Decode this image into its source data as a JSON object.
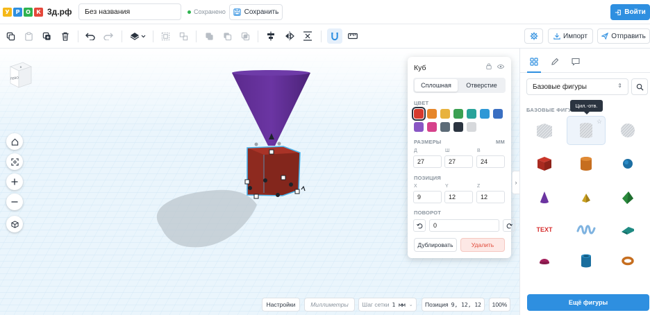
{
  "brand": {
    "letters": [
      "У",
      "Р",
      "О",
      "К"
    ],
    "letter_colors": [
      "#f5b818",
      "#2e8fe0",
      "#2eb24f",
      "#e5483b"
    ],
    "domain": "3д.рф"
  },
  "header": {
    "document_name": "Без названия",
    "save_status": "Сохранено",
    "save_button": "Сохранить",
    "login_button": "Войти"
  },
  "toolbar": {
    "icons": [
      "copy-icon",
      "paste-icon",
      "duplicate-icon",
      "trash-icon",
      "undo-icon",
      "redo-icon",
      "workplane-icon",
      "group-icon",
      "ungroup-icon",
      "boolean-union-icon",
      "boolean-subtract-icon",
      "boolean-intersect-icon",
      "align-icon",
      "mirror-icon",
      "cruise-icon",
      "magnet-icon",
      "ruler-icon"
    ],
    "import_button": "Импорт",
    "send_button": "Отправить"
  },
  "viewcube": {
    "face_label": "ЛЕВО",
    "top_label": "В"
  },
  "inspector": {
    "title": "Куб",
    "mode_solid": "Сплошная",
    "mode_hole": "Отверстие",
    "color_label": "ЦВЕТ",
    "colors": [
      "#d63a2e",
      "#e6862a",
      "#e8b23d",
      "#3aa052",
      "#28a39a",
      "#2e98d6",
      "#3a6fc2",
      "#8956c4",
      "#d6428b",
      "#5c6b77",
      "#2b3440",
      "#d7d9dc"
    ],
    "selected_color": "#d63a2e",
    "size_label": "РАЗМЕРЫ",
    "unit": "ММ",
    "size": {
      "d_label": "Д",
      "w_label": "Ш",
      "h_label": "В",
      "d": "27",
      "w": "27",
      "h": "24"
    },
    "position_label": "ПОЗИЦИЯ",
    "position": {
      "x_label": "X",
      "y_label": "Y",
      "z_label": "Z",
      "x": "9",
      "y": "12",
      "z": "12"
    },
    "rotation_label": "ПОВОРОТ",
    "rotation": "0",
    "duplicate_button": "Дублировать",
    "delete_button": "Удалить"
  },
  "bottom": {
    "settings_button": "Настройки",
    "units_button": "Миллиметры",
    "grid_label": "Шаг сетки",
    "grid_value": "1 мм",
    "position_label": "Позиция",
    "position_value": "9, 12, 12",
    "zoom": "100%"
  },
  "library": {
    "category": "Базовые фигуры",
    "section_title": "БАЗОВЫЕ ФИГУРЫ",
    "tooltip": "Цил.-отв.",
    "more_button": "Ещё фигуры",
    "shapes": [
      "box-hole",
      "cylinder-hole",
      "sphere-hole",
      "box",
      "cylinder",
      "sphere",
      "cone",
      "pyramid",
      "roof",
      "text",
      "scribble",
      "wedge",
      "half-sphere",
      "tube",
      "torus"
    ],
    "text_shape_label": "TEXT"
  }
}
